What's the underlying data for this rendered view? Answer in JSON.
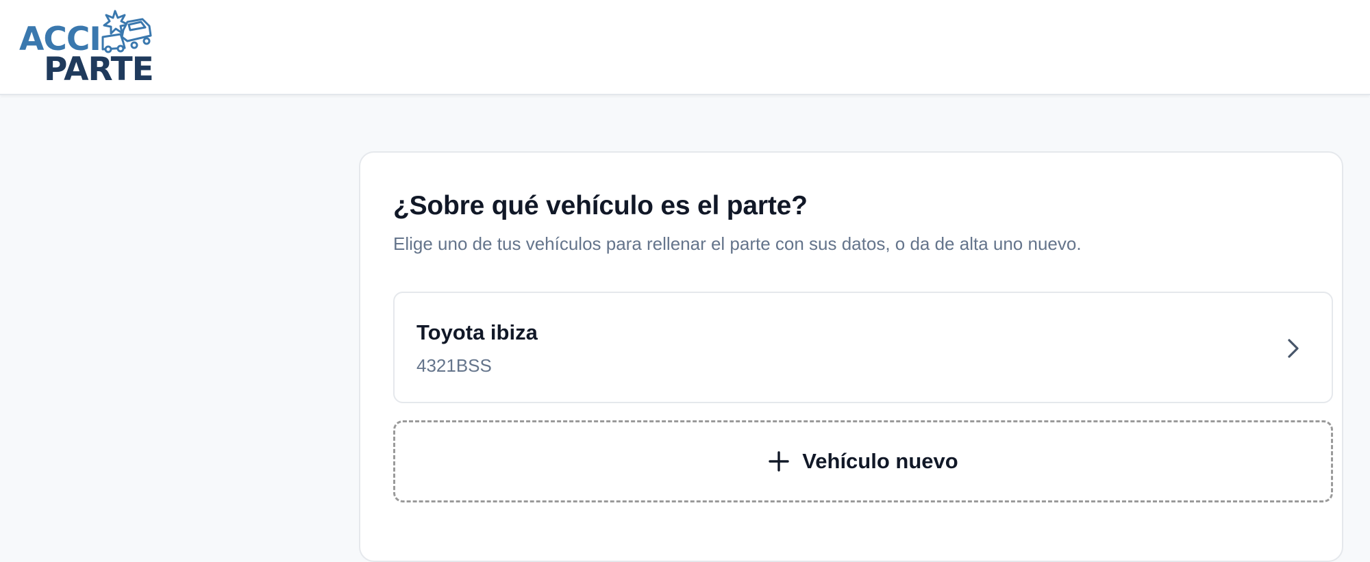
{
  "header": {
    "logo": {
      "line1": "ACCI",
      "line2": "PARTE",
      "icon": "crashed-car-icon"
    }
  },
  "vehicle_selection": {
    "title": "¿Sobre qué vehículo es el parte?",
    "subtitle": "Elige uno de tus vehículos para rellenar el parte con sus datos, o da de alta uno nuevo.",
    "vehicles": [
      {
        "name": "Toyota ibiza",
        "plate": "4321BSS",
        "icon": "chevron-right-icon"
      }
    ],
    "new_vehicle": {
      "label": "Vehículo nuevo",
      "icon": "plus-icon"
    }
  },
  "colors": {
    "brand_light": "#3a78ae",
    "brand_dark": "#1f3a5c",
    "text_primary": "#111827",
    "text_secondary": "#64748b",
    "page_background": "#f7f9fb",
    "border": "#e5e8ec",
    "dashed_border": "#9a9a9a"
  }
}
